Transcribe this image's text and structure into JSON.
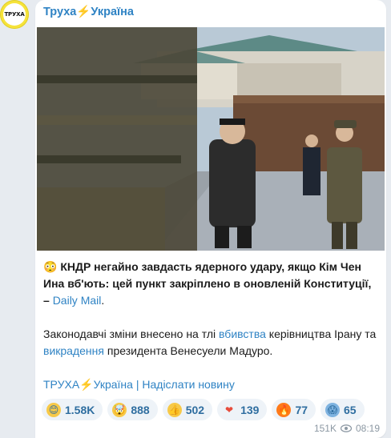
{
  "channel": {
    "name": "Труха⚡Україна",
    "avatar_text": "ТРУХА"
  },
  "message": {
    "headline_emoji": "😳",
    "headline_bold": "КНДР негайно завдасть ядерного удару, якщо Кім Чен Ина вб'ють: цей пункт закріплено в оновленій Конституції, –",
    "headline_link": "Daily Mail",
    "headline_end": ".",
    "para2_part1": "Законодавчі зміни внесено на тлі ",
    "para2_link1": "вбивства",
    "para2_part2": " керівництва Ірану та ",
    "para2_link2": "викрадення",
    "para2_part3": " президента Венесуели Мадуро.",
    "footer_channel": "ТРУХА⚡Україна",
    "footer_sep": " | ",
    "footer_submit": "Надіслати новину"
  },
  "reactions": [
    {
      "icon": "smile-icon",
      "emoji": "😊",
      "count": "1.58K",
      "bg": "#f7c948"
    },
    {
      "icon": "exploding-head-icon",
      "emoji": "🤯",
      "count": "888",
      "bg": "#f7c948"
    },
    {
      "icon": "thumbs-up-icon",
      "emoji": "👍",
      "count": "502",
      "bg": "#f7c948"
    },
    {
      "icon": "heart-icon",
      "emoji": "❤",
      "count": "139",
      "bg": "#e74c3c"
    },
    {
      "icon": "fire-icon",
      "emoji": "🔥",
      "count": "77",
      "bg": "#ff7a1a"
    },
    {
      "icon": "scream-icon",
      "emoji": "😱",
      "count": "65",
      "bg": "#7fb3e0"
    }
  ],
  "meta": {
    "views": "151K",
    "time": "08:19"
  },
  "colors": {
    "link": "#2f83c4",
    "avatar_bg": "#f6e33a",
    "reaction_bg": "#eef3f8"
  }
}
